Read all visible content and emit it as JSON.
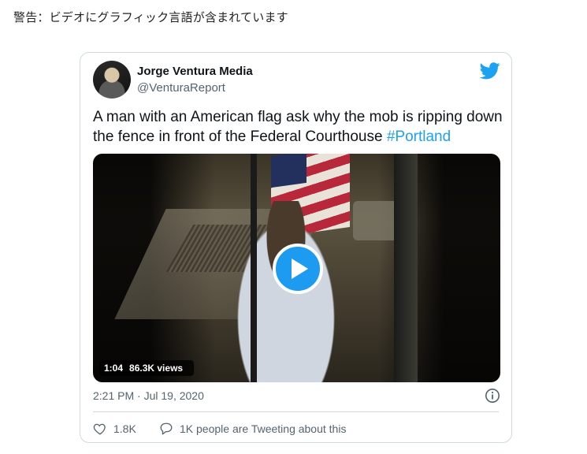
{
  "warning": "警告：ビデオにグラフィック言語が含まれています",
  "tweet": {
    "author_name": "Jorge Ventura Media",
    "author_handle": "@VenturaReport",
    "text": "A man with an American flag ask why the mob is ripping down the fence in front of the Federal Courthouse ",
    "hashtag": "#Portland",
    "video_duration": "1:04",
    "video_views": "86.3K views",
    "timestamp": "2:21 PM · Jul 19, 2020",
    "like_count": "1.8K",
    "reply_label": "1K people are Tweeting about this"
  },
  "icons": {
    "logo": "twitter-bird-icon",
    "play": "play-icon",
    "info": "info-icon",
    "like": "heart-icon",
    "reply": "comment-icon"
  },
  "colors": {
    "accent": "#1da1f2",
    "text": "#0f1419",
    "muted": "#536471",
    "border": "#cfd9de"
  }
}
